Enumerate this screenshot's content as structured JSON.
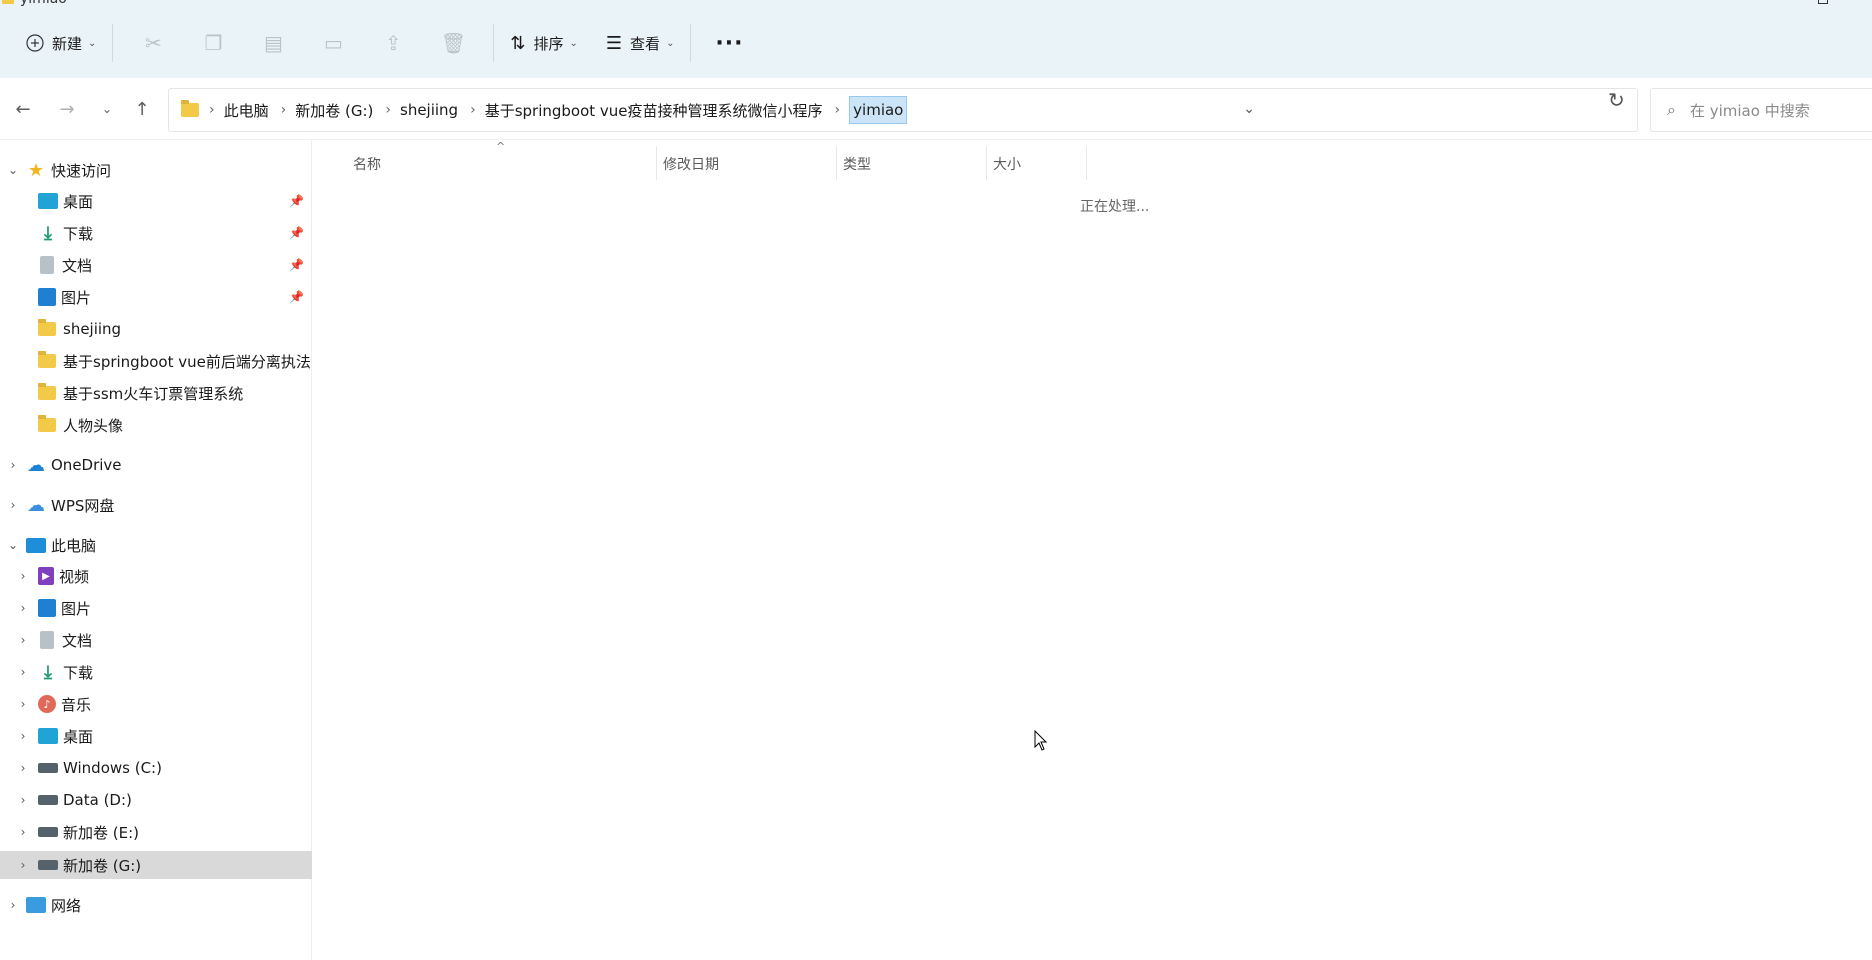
{
  "window": {
    "title": "yimiao"
  },
  "toolbar": {
    "new_label": "新建",
    "sort_label": "排序",
    "view_label": "查看",
    "more_label": "···"
  },
  "address": {
    "crumbs": [
      "此电脑",
      "新加卷 (G:)",
      "shejiing",
      "基于springboot vue疫苗接种管理系统微信小程序"
    ],
    "current": "yimiao"
  },
  "search": {
    "placeholder": "在 yimiao 中搜索"
  },
  "sidebar": {
    "quick_access": "快速访问",
    "quick_items": [
      {
        "label": "桌面",
        "icon": "desktop-icon"
      },
      {
        "label": "下载",
        "icon": "download-icon"
      },
      {
        "label": "文档",
        "icon": "document-icon"
      },
      {
        "label": "图片",
        "icon": "pictures-icon"
      },
      {
        "label": "shejiing",
        "icon": "folder-icon"
      },
      {
        "label": "基于springboot vue前后端分离执法",
        "icon": "folder-icon"
      },
      {
        "label": "基于ssm火车订票管理系统",
        "icon": "folder-icon"
      },
      {
        "label": "人物头像",
        "icon": "folder-icon"
      }
    ],
    "onedrive": "OneDrive",
    "wps": "WPS网盘",
    "this_pc": "此电脑",
    "pc_items": [
      {
        "label": "视频",
        "icon": "videos-icon"
      },
      {
        "label": "图片",
        "icon": "pictures-icon"
      },
      {
        "label": "文档",
        "icon": "document-icon"
      },
      {
        "label": "下载",
        "icon": "download-icon"
      },
      {
        "label": "音乐",
        "icon": "music-icon"
      },
      {
        "label": "桌面",
        "icon": "desktop-icon"
      },
      {
        "label": "Windows (C:)",
        "icon": "drive-icon"
      },
      {
        "label": "Data (D:)",
        "icon": "drive-icon"
      },
      {
        "label": "新加卷 (E:)",
        "icon": "drive-icon"
      },
      {
        "label": "新加卷 (G:)",
        "icon": "drive-icon"
      }
    ],
    "network": "网络"
  },
  "columns": {
    "name": "名称",
    "modified": "修改日期",
    "type": "类型",
    "size": "大小"
  },
  "status": {
    "processing": "正在处理..."
  },
  "colors": {
    "toolbar_bg": "#eaf3f7",
    "selection_bg": "#cce4f7",
    "sidebar_selected": "#d9d9d9",
    "folder": "#f3c948"
  }
}
